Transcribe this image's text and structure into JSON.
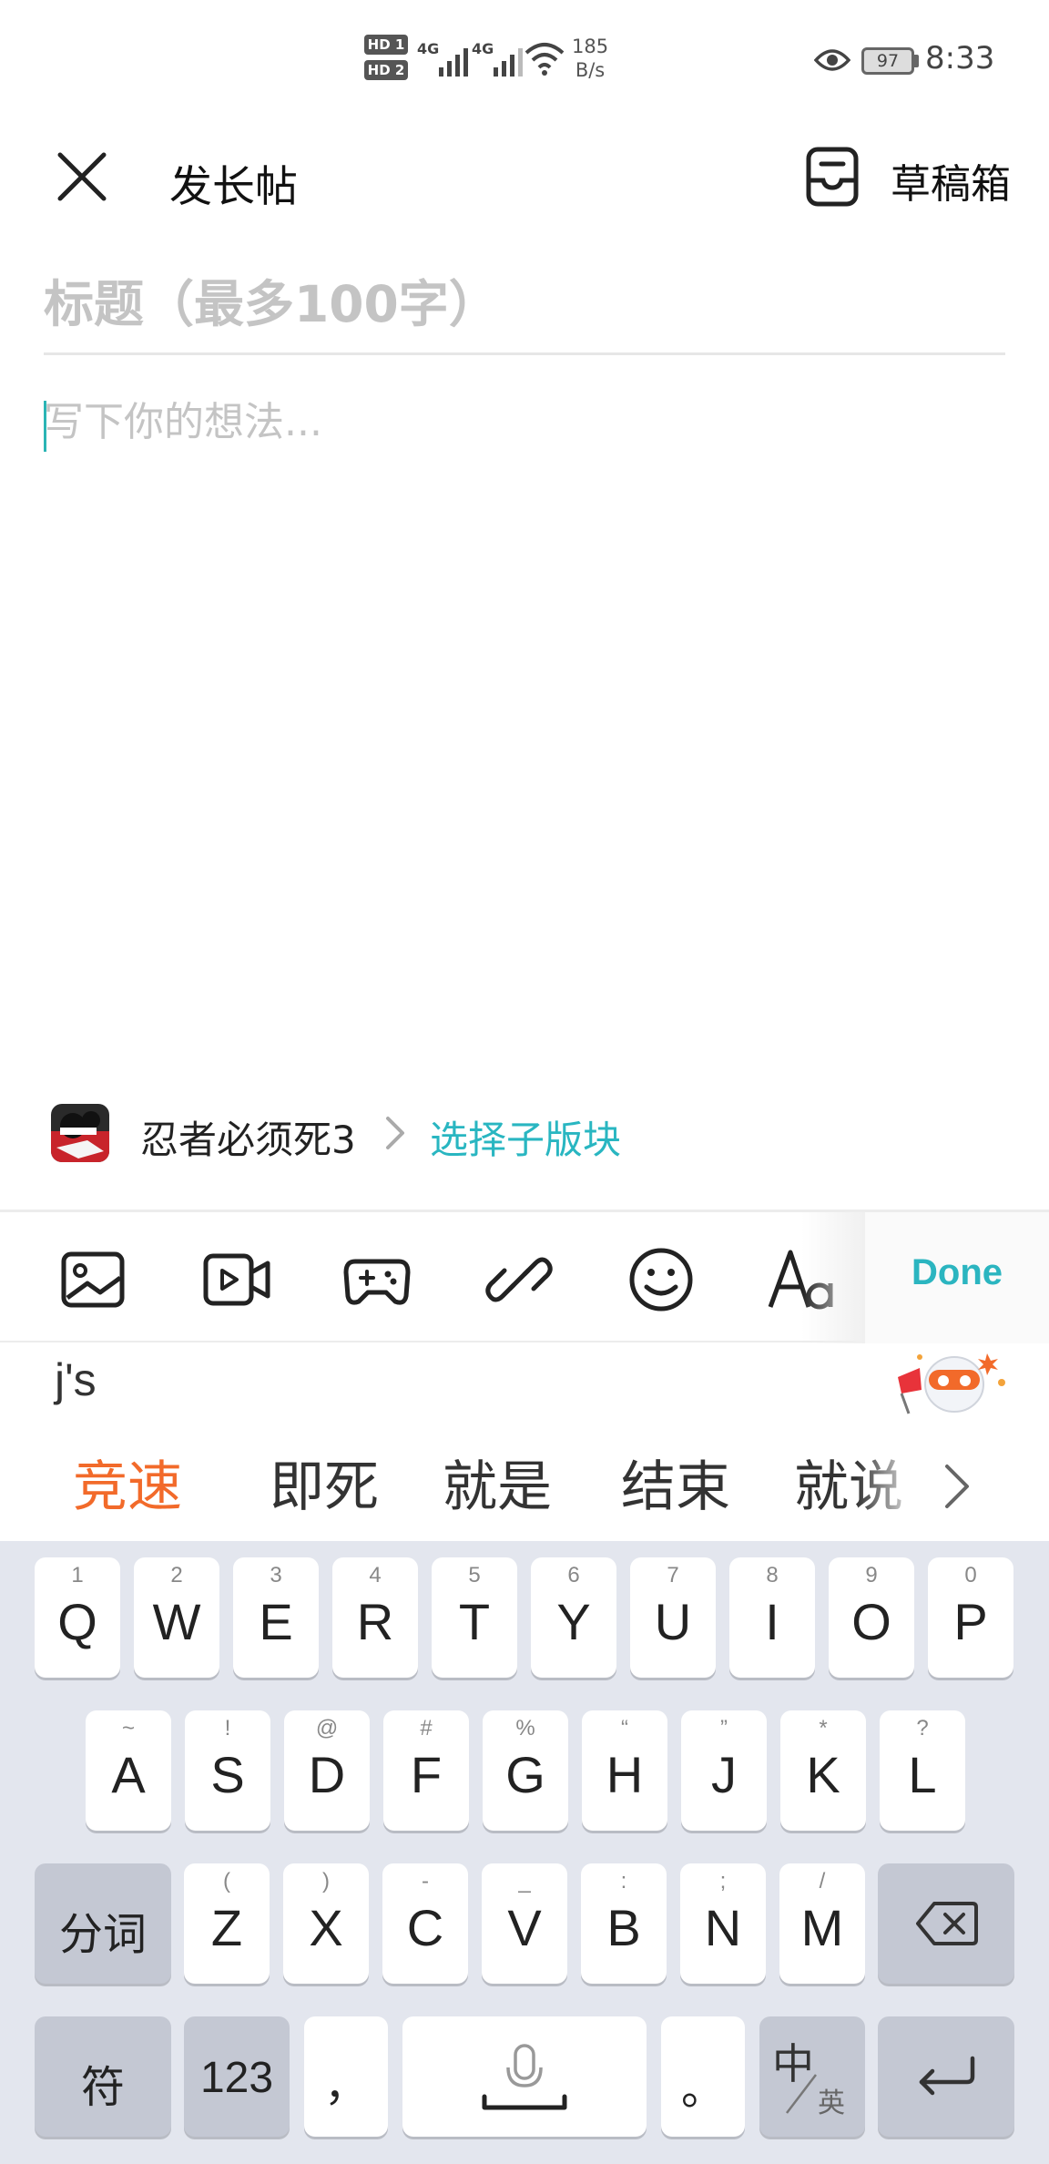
{
  "status_bar": {
    "sim1": "HD 1",
    "sim2": "HD 2",
    "net1": "4G",
    "net2": "4G",
    "speed_value": "185",
    "speed_unit": "B/s",
    "battery": "97",
    "time": "8:33",
    "icons": [
      "eye-icon",
      "wifi-icon",
      "signal-icon",
      "battery-icon"
    ]
  },
  "header": {
    "title": "发长帖",
    "drafts_label": "草稿箱"
  },
  "editor": {
    "title_placeholder": "标题（最多100字）",
    "body_placeholder": "写下你的想法..."
  },
  "forum": {
    "name": "忍者必须死3",
    "sub_forum_label": "选择子版块",
    "accent": "#29b6c1"
  },
  "toolbar": {
    "tools": [
      "image-icon",
      "video-icon",
      "game-icon",
      "link-icon",
      "emoji-icon",
      "text-format-icon"
    ],
    "done_label": "Done"
  },
  "ime": {
    "pinyin": "j's",
    "candidates": [
      "竞速",
      "即死",
      "就是",
      "结束",
      "就说"
    ],
    "highlight_color": "#f26a2a"
  },
  "keyboard": {
    "row1": [
      {
        "hint": "1",
        "key": "Q"
      },
      {
        "hint": "2",
        "key": "W"
      },
      {
        "hint": "3",
        "key": "E"
      },
      {
        "hint": "4",
        "key": "R"
      },
      {
        "hint": "5",
        "key": "T"
      },
      {
        "hint": "6",
        "key": "Y"
      },
      {
        "hint": "7",
        "key": "U"
      },
      {
        "hint": "8",
        "key": "I"
      },
      {
        "hint": "9",
        "key": "O"
      },
      {
        "hint": "0",
        "key": "P"
      }
    ],
    "row2": [
      {
        "hint": "~",
        "key": "A"
      },
      {
        "hint": "!",
        "key": "S"
      },
      {
        "hint": "@",
        "key": "D"
      },
      {
        "hint": "#",
        "key": "F"
      },
      {
        "hint": "%",
        "key": "G"
      },
      {
        "hint": "“",
        "key": "H"
      },
      {
        "hint": "”",
        "key": "J"
      },
      {
        "hint": "*",
        "key": "K"
      },
      {
        "hint": "?",
        "key": "L"
      }
    ],
    "row3": [
      {
        "hint": "(",
        "key": "Z"
      },
      {
        "hint": ")",
        "key": "X"
      },
      {
        "hint": "-",
        "key": "C"
      },
      {
        "hint": "_",
        "key": "V"
      },
      {
        "hint": ":",
        "key": "B"
      },
      {
        "hint": ";",
        "key": "N"
      },
      {
        "hint": "/",
        "key": "M"
      }
    ],
    "segment_label": "分词",
    "symbol_label": "符",
    "number_label": "123",
    "comma_label": "，",
    "period_label": "。",
    "lang_main": "中",
    "lang_sub": "英"
  }
}
